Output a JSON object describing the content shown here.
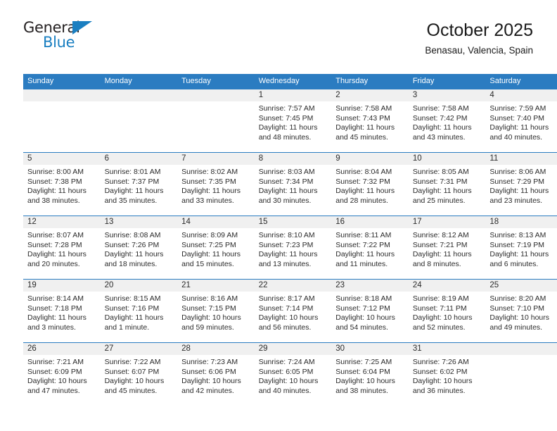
{
  "brand": {
    "name_line1": "General",
    "name_line2": "Blue",
    "triangle_icon": "triangle-icon",
    "accent_color": "#1a7fc1"
  },
  "header": {
    "month_title": "October 2025",
    "location": "Benasau, Valencia, Spain"
  },
  "theme": {
    "header_blue": "#2b7cc1",
    "daynum_band": "#f0f0f0",
    "text": "#2b2b2b"
  },
  "calendar": {
    "weekday_headers": [
      "Sunday",
      "Monday",
      "Tuesday",
      "Wednesday",
      "Thursday",
      "Friday",
      "Saturday"
    ],
    "weeks": [
      [
        {
          "empty": true
        },
        {
          "empty": true
        },
        {
          "empty": true
        },
        {
          "day": "1",
          "sunrise": "Sunrise: 7:57 AM",
          "sunset": "Sunset: 7:45 PM",
          "daylight1": "Daylight: 11 hours",
          "daylight2": "and 48 minutes."
        },
        {
          "day": "2",
          "sunrise": "Sunrise: 7:58 AM",
          "sunset": "Sunset: 7:43 PM",
          "daylight1": "Daylight: 11 hours",
          "daylight2": "and 45 minutes."
        },
        {
          "day": "3",
          "sunrise": "Sunrise: 7:58 AM",
          "sunset": "Sunset: 7:42 PM",
          "daylight1": "Daylight: 11 hours",
          "daylight2": "and 43 minutes."
        },
        {
          "day": "4",
          "sunrise": "Sunrise: 7:59 AM",
          "sunset": "Sunset: 7:40 PM",
          "daylight1": "Daylight: 11 hours",
          "daylight2": "and 40 minutes."
        }
      ],
      [
        {
          "day": "5",
          "sunrise": "Sunrise: 8:00 AM",
          "sunset": "Sunset: 7:38 PM",
          "daylight1": "Daylight: 11 hours",
          "daylight2": "and 38 minutes."
        },
        {
          "day": "6",
          "sunrise": "Sunrise: 8:01 AM",
          "sunset": "Sunset: 7:37 PM",
          "daylight1": "Daylight: 11 hours",
          "daylight2": "and 35 minutes."
        },
        {
          "day": "7",
          "sunrise": "Sunrise: 8:02 AM",
          "sunset": "Sunset: 7:35 PM",
          "daylight1": "Daylight: 11 hours",
          "daylight2": "and 33 minutes."
        },
        {
          "day": "8",
          "sunrise": "Sunrise: 8:03 AM",
          "sunset": "Sunset: 7:34 PM",
          "daylight1": "Daylight: 11 hours",
          "daylight2": "and 30 minutes."
        },
        {
          "day": "9",
          "sunrise": "Sunrise: 8:04 AM",
          "sunset": "Sunset: 7:32 PM",
          "daylight1": "Daylight: 11 hours",
          "daylight2": "and 28 minutes."
        },
        {
          "day": "10",
          "sunrise": "Sunrise: 8:05 AM",
          "sunset": "Sunset: 7:31 PM",
          "daylight1": "Daylight: 11 hours",
          "daylight2": "and 25 minutes."
        },
        {
          "day": "11",
          "sunrise": "Sunrise: 8:06 AM",
          "sunset": "Sunset: 7:29 PM",
          "daylight1": "Daylight: 11 hours",
          "daylight2": "and 23 minutes."
        }
      ],
      [
        {
          "day": "12",
          "sunrise": "Sunrise: 8:07 AM",
          "sunset": "Sunset: 7:28 PM",
          "daylight1": "Daylight: 11 hours",
          "daylight2": "and 20 minutes."
        },
        {
          "day": "13",
          "sunrise": "Sunrise: 8:08 AM",
          "sunset": "Sunset: 7:26 PM",
          "daylight1": "Daylight: 11 hours",
          "daylight2": "and 18 minutes."
        },
        {
          "day": "14",
          "sunrise": "Sunrise: 8:09 AM",
          "sunset": "Sunset: 7:25 PM",
          "daylight1": "Daylight: 11 hours",
          "daylight2": "and 15 minutes."
        },
        {
          "day": "15",
          "sunrise": "Sunrise: 8:10 AM",
          "sunset": "Sunset: 7:23 PM",
          "daylight1": "Daylight: 11 hours",
          "daylight2": "and 13 minutes."
        },
        {
          "day": "16",
          "sunrise": "Sunrise: 8:11 AM",
          "sunset": "Sunset: 7:22 PM",
          "daylight1": "Daylight: 11 hours",
          "daylight2": "and 11 minutes."
        },
        {
          "day": "17",
          "sunrise": "Sunrise: 8:12 AM",
          "sunset": "Sunset: 7:21 PM",
          "daylight1": "Daylight: 11 hours",
          "daylight2": "and 8 minutes."
        },
        {
          "day": "18",
          "sunrise": "Sunrise: 8:13 AM",
          "sunset": "Sunset: 7:19 PM",
          "daylight1": "Daylight: 11 hours",
          "daylight2": "and 6 minutes."
        }
      ],
      [
        {
          "day": "19",
          "sunrise": "Sunrise: 8:14 AM",
          "sunset": "Sunset: 7:18 PM",
          "daylight1": "Daylight: 11 hours",
          "daylight2": "and 3 minutes."
        },
        {
          "day": "20",
          "sunrise": "Sunrise: 8:15 AM",
          "sunset": "Sunset: 7:16 PM",
          "daylight1": "Daylight: 11 hours",
          "daylight2": "and 1 minute."
        },
        {
          "day": "21",
          "sunrise": "Sunrise: 8:16 AM",
          "sunset": "Sunset: 7:15 PM",
          "daylight1": "Daylight: 10 hours",
          "daylight2": "and 59 minutes."
        },
        {
          "day": "22",
          "sunrise": "Sunrise: 8:17 AM",
          "sunset": "Sunset: 7:14 PM",
          "daylight1": "Daylight: 10 hours",
          "daylight2": "and 56 minutes."
        },
        {
          "day": "23",
          "sunrise": "Sunrise: 8:18 AM",
          "sunset": "Sunset: 7:12 PM",
          "daylight1": "Daylight: 10 hours",
          "daylight2": "and 54 minutes."
        },
        {
          "day": "24",
          "sunrise": "Sunrise: 8:19 AM",
          "sunset": "Sunset: 7:11 PM",
          "daylight1": "Daylight: 10 hours",
          "daylight2": "and 52 minutes."
        },
        {
          "day": "25",
          "sunrise": "Sunrise: 8:20 AM",
          "sunset": "Sunset: 7:10 PM",
          "daylight1": "Daylight: 10 hours",
          "daylight2": "and 49 minutes."
        }
      ],
      [
        {
          "day": "26",
          "sunrise": "Sunrise: 7:21 AM",
          "sunset": "Sunset: 6:09 PM",
          "daylight1": "Daylight: 10 hours",
          "daylight2": "and 47 minutes."
        },
        {
          "day": "27",
          "sunrise": "Sunrise: 7:22 AM",
          "sunset": "Sunset: 6:07 PM",
          "daylight1": "Daylight: 10 hours",
          "daylight2": "and 45 minutes."
        },
        {
          "day": "28",
          "sunrise": "Sunrise: 7:23 AM",
          "sunset": "Sunset: 6:06 PM",
          "daylight1": "Daylight: 10 hours",
          "daylight2": "and 42 minutes."
        },
        {
          "day": "29",
          "sunrise": "Sunrise: 7:24 AM",
          "sunset": "Sunset: 6:05 PM",
          "daylight1": "Daylight: 10 hours",
          "daylight2": "and 40 minutes."
        },
        {
          "day": "30",
          "sunrise": "Sunrise: 7:25 AM",
          "sunset": "Sunset: 6:04 PM",
          "daylight1": "Daylight: 10 hours",
          "daylight2": "and 38 minutes."
        },
        {
          "day": "31",
          "sunrise": "Sunrise: 7:26 AM",
          "sunset": "Sunset: 6:02 PM",
          "daylight1": "Daylight: 10 hours",
          "daylight2": "and 36 minutes."
        },
        {
          "empty": true
        }
      ]
    ]
  }
}
